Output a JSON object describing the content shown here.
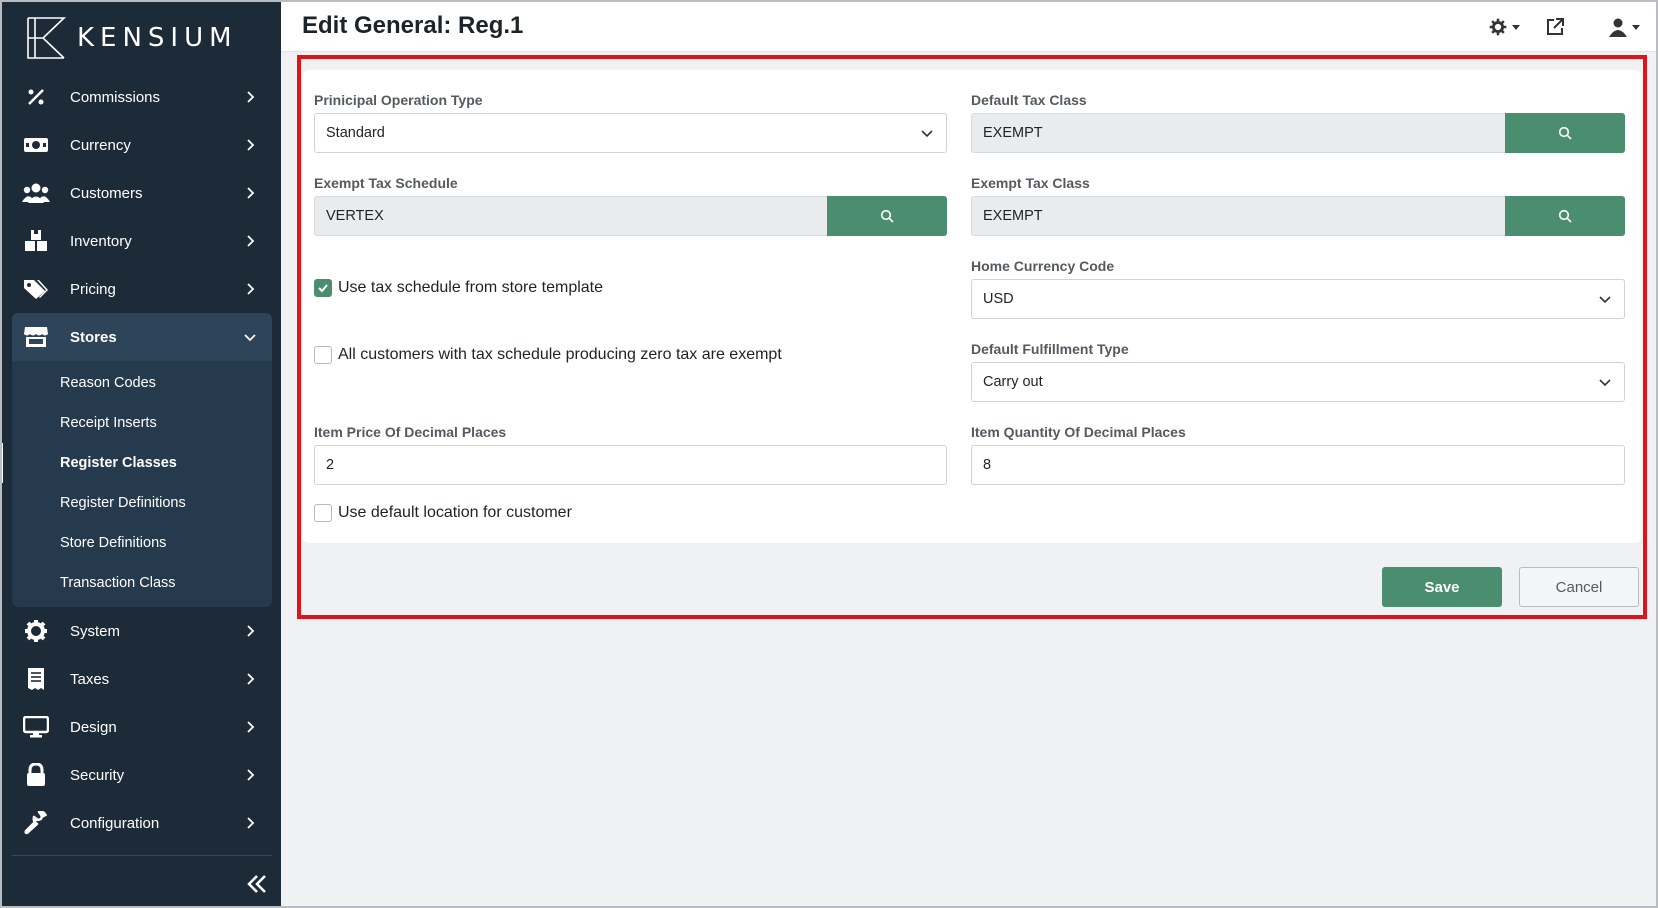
{
  "app": {
    "brand": "KENSIUM"
  },
  "header": {
    "title": "Edit General: Reg.1"
  },
  "sidebar": {
    "items_top": [
      {
        "label": "Commissions",
        "icon": "percent-icon"
      },
      {
        "label": "Currency",
        "icon": "money-icon"
      },
      {
        "label": "Customers",
        "icon": "users-icon"
      },
      {
        "label": "Inventory",
        "icon": "boxes-icon"
      },
      {
        "label": "Pricing",
        "icon": "tags-icon"
      }
    ],
    "active": {
      "label": "Stores",
      "icon": "store-icon"
    },
    "subitems": [
      {
        "label": "Reason Codes"
      },
      {
        "label": "Receipt Inserts"
      },
      {
        "label": "Register Classes",
        "active": true
      },
      {
        "label": "Register Definitions"
      },
      {
        "label": "Store Definitions"
      },
      {
        "label": "Transaction Class"
      }
    ],
    "items_bottom": [
      {
        "label": "System",
        "icon": "gear-icon"
      },
      {
        "label": "Taxes",
        "icon": "receipt-icon"
      },
      {
        "label": "Design",
        "icon": "monitor-icon"
      },
      {
        "label": "Security",
        "icon": "lock-icon"
      },
      {
        "label": "Configuration",
        "icon": "wrench-icon"
      }
    ]
  },
  "form": {
    "principal_operation_type": {
      "label": "Prinicipal Operation Type",
      "value": "Standard"
    },
    "default_tax_class": {
      "label": "Default Tax Class",
      "value": "EXEMPT"
    },
    "exempt_tax_schedule": {
      "label": "Exempt Tax Schedule",
      "value": "VERTEX"
    },
    "exempt_tax_class": {
      "label": "Exempt Tax Class",
      "value": "EXEMPT"
    },
    "use_tax_schedule": {
      "label": "Use tax schedule from store template",
      "checked": true
    },
    "home_currency_code": {
      "label": "Home Currency Code",
      "value": "USD"
    },
    "zero_tax_exempt": {
      "label": "All customers with tax schedule producing zero tax are exempt",
      "checked": false
    },
    "default_fulfillment_type": {
      "label": "Default Fulfillment Type",
      "value": "Carry out"
    },
    "item_price_decimals": {
      "label": "Item Price Of Decimal Places",
      "value": "2"
    },
    "item_quantity_decimals": {
      "label": "Item Quantity Of Decimal Places",
      "value": "8"
    },
    "use_default_location": {
      "label": "Use default location for customer",
      "checked": false
    }
  },
  "actions": {
    "save": "Save",
    "cancel": "Cancel"
  },
  "colors": {
    "sidebar": "#1d2b38",
    "accent": "#4b8e6f",
    "highlight": "#e0121a"
  }
}
